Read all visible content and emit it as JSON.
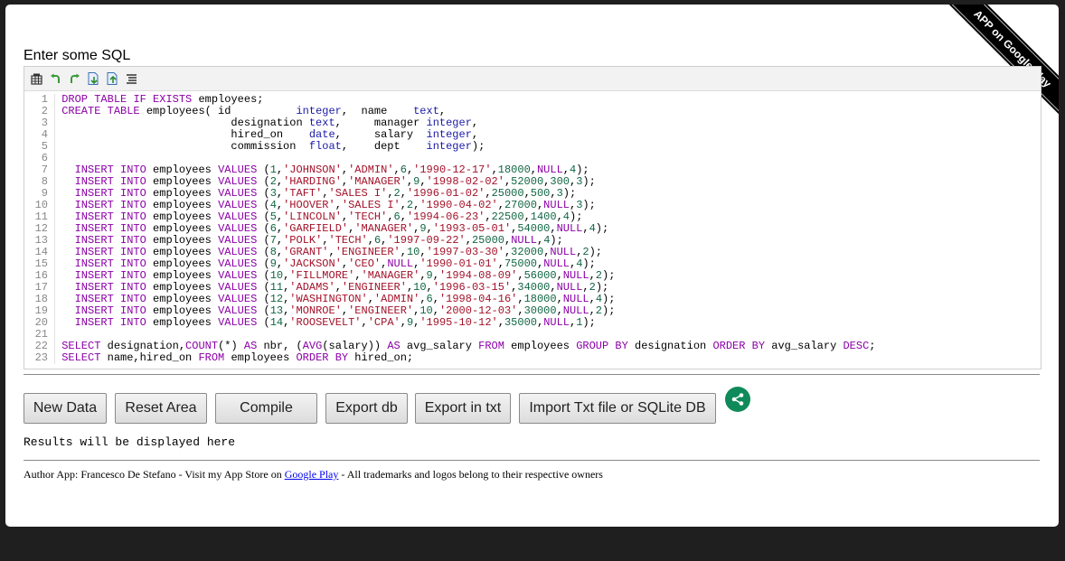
{
  "ribbon": {
    "label": "APP on Google Play"
  },
  "heading": "Enter some SQL",
  "toolbar": {
    "icons": [
      "grid-icon",
      "undo-icon",
      "redo-icon",
      "file-import-icon",
      "file-export-icon",
      "format-icon"
    ]
  },
  "editor": {
    "lines": [
      "DROP TABLE IF EXISTS employees;",
      "CREATE TABLE employees( id          integer,  name    text,",
      "                          designation text,     manager integer,",
      "                          hired_on    date,     salary  integer,",
      "                          commission  float,    dept    integer);",
      "",
      "  INSERT INTO employees VALUES (1,'JOHNSON','ADMIN',6,'1990-12-17',18000,NULL,4);",
      "  INSERT INTO employees VALUES (2,'HARDING','MANAGER',9,'1998-02-02',52000,300,3);",
      "  INSERT INTO employees VALUES (3,'TAFT','SALES I',2,'1996-01-02',25000,500,3);",
      "  INSERT INTO employees VALUES (4,'HOOVER','SALES I',2,'1990-04-02',27000,NULL,3);",
      "  INSERT INTO employees VALUES (5,'LINCOLN','TECH',6,'1994-06-23',22500,1400,4);",
      "  INSERT INTO employees VALUES (6,'GARFIELD','MANAGER',9,'1993-05-01',54000,NULL,4);",
      "  INSERT INTO employees VALUES (7,'POLK','TECH',6,'1997-09-22',25000,NULL,4);",
      "  INSERT INTO employees VALUES (8,'GRANT','ENGINEER',10,'1997-03-30',32000,NULL,2);",
      "  INSERT INTO employees VALUES (9,'JACKSON','CEO',NULL,'1990-01-01',75000,NULL,4);",
      "  INSERT INTO employees VALUES (10,'FILLMORE','MANAGER',9,'1994-08-09',56000,NULL,2);",
      "  INSERT INTO employees VALUES (11,'ADAMS','ENGINEER',10,'1996-03-15',34000,NULL,2);",
      "  INSERT INTO employees VALUES (12,'WASHINGTON','ADMIN',6,'1998-04-16',18000,NULL,4);",
      "  INSERT INTO employees VALUES (13,'MONROE','ENGINEER',10,'2000-12-03',30000,NULL,2);",
      "  INSERT INTO employees VALUES (14,'ROOSEVELT','CPA',9,'1995-10-12',35000,NULL,1);",
      "",
      "SELECT designation,COUNT(*) AS nbr, (AVG(salary)) AS avg_salary FROM employees GROUP BY designation ORDER BY avg_salary DESC;",
      "SELECT name,hired_on FROM employees ORDER BY hired_on;"
    ]
  },
  "buttons": {
    "new_data": "New Data",
    "reset_area": "Reset Area",
    "compile": "Compile",
    "export_db": "Export db",
    "export_txt": "Export in txt",
    "import": "Import Txt file or SQLite DB"
  },
  "results": "Results will be displayed here",
  "footer": {
    "before": "Author App: Francesco De Stefano - Visit my App Store on ",
    "link": "Google Play",
    "after": " - All trademarks and logos belong to their respective owners"
  },
  "colors": {
    "keyword": "#8b00a6",
    "type": "#1b1ba6",
    "string": "#a3122a",
    "number": "#116644",
    "share": "#0f8a5a"
  }
}
